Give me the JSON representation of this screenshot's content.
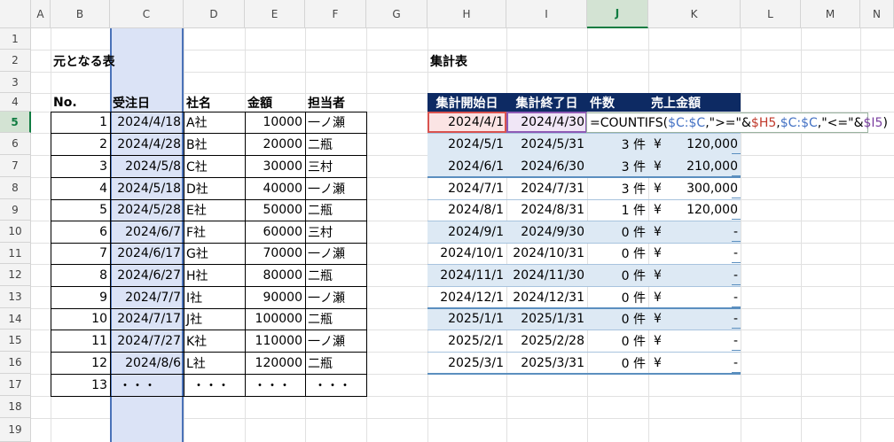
{
  "columns": [
    "A",
    "B",
    "C",
    "D",
    "E",
    "F",
    "G",
    "H",
    "I",
    "J",
    "K",
    "L",
    "M",
    "N"
  ],
  "rows": [
    "1",
    "2",
    "3",
    "4",
    "5",
    "6",
    "7",
    "8",
    "9",
    "10",
    "11",
    "12",
    "13",
    "14",
    "15",
    "16",
    "17",
    "18",
    "19"
  ],
  "active_row": "5",
  "active_column": "J",
  "left_title": "元となる表",
  "right_title": "集計表",
  "left_headers": [
    "No.",
    "受注日",
    "社名",
    "金額",
    "担当者"
  ],
  "left_rows": [
    [
      "1",
      "2024/4/18",
      "A社",
      "10000",
      "一ノ瀬"
    ],
    [
      "2",
      "2024/4/28",
      "B社",
      "20000",
      "二瓶"
    ],
    [
      "3",
      "2024/5/8",
      "C社",
      "30000",
      "三村"
    ],
    [
      "4",
      "2024/5/18",
      "D社",
      "40000",
      "一ノ瀬"
    ],
    [
      "5",
      "2024/5/28",
      "E社",
      "50000",
      "二瓶"
    ],
    [
      "6",
      "2024/6/7",
      "F社",
      "60000",
      "三村"
    ],
    [
      "7",
      "2024/6/17",
      "G社",
      "70000",
      "一ノ瀬"
    ],
    [
      "8",
      "2024/6/27",
      "H社",
      "80000",
      "二瓶"
    ],
    [
      "9",
      "2024/7/7",
      "I社",
      "90000",
      "一ノ瀬"
    ],
    [
      "10",
      "2024/7/17",
      "J社",
      "100000",
      "二瓶"
    ],
    [
      "11",
      "2024/7/27",
      "K社",
      "110000",
      "一ノ瀬"
    ],
    [
      "12",
      "2024/8/6",
      "L社",
      "120000",
      "二瓶"
    ],
    [
      "13",
      "・・・",
      "・・・",
      "・・・",
      "・・・"
    ]
  ],
  "right_headers": [
    "集計開始日",
    "集計終了日",
    "件数",
    "売上金額"
  ],
  "right_rows": [
    [
      "2024/4/1",
      "2024/4/30",
      "",
      ""
    ],
    [
      "2024/5/1",
      "2024/5/31",
      "3 件",
      "¥",
      "120,000"
    ],
    [
      "2024/6/1",
      "2024/6/30",
      "3 件",
      "¥",
      "210,000"
    ],
    [
      "2024/7/1",
      "2024/7/31",
      "3 件",
      "¥",
      "300,000"
    ],
    [
      "2024/8/1",
      "2024/8/31",
      "1 件",
      "¥",
      "120,000"
    ],
    [
      "2024/9/1",
      "2024/9/30",
      "0 件",
      "¥",
      "-"
    ],
    [
      "2024/10/1",
      "2024/10/31",
      "0 件",
      "¥",
      "-"
    ],
    [
      "2024/11/1",
      "2024/11/30",
      "0 件",
      "¥",
      "-"
    ],
    [
      "2024/12/1",
      "2024/12/31",
      "0 件",
      "¥",
      "-"
    ],
    [
      "2025/1/1",
      "2025/1/31",
      "0 件",
      "¥",
      "-"
    ],
    [
      "2025/2/1",
      "2025/2/28",
      "0 件",
      "¥",
      "-"
    ],
    [
      "2025/3/1",
      "2025/3/31",
      "0 件",
      "¥",
      "-"
    ]
  ],
  "formula": {
    "parts": [
      {
        "text": "=COUNTIFS(",
        "color": "#000000"
      },
      {
        "text": "$C:$C",
        "color": "#4472c4"
      },
      {
        "text": ",\">=\"&",
        "color": "#000000"
      },
      {
        "text": "$H5",
        "color": "#c0392b"
      },
      {
        "text": ",",
        "color": "#000000"
      },
      {
        "text": "$C:$C",
        "color": "#4472c4"
      },
      {
        "text": ",\"<=\"&",
        "color": "#000000"
      },
      {
        "text": "$I5",
        "color": "#7b3fa0"
      },
      {
        "text": ")",
        "color": "#000000"
      }
    ]
  },
  "colors": {
    "header_navy": "#0d2a63",
    "band_blue": "#dde9f4",
    "column_c_highlight": "#dbe3f6",
    "column_c_border": "#4a72b8",
    "ref_h5_fill": "#fbe4e4",
    "ref_h5_border": "#d9534f",
    "ref_i5_fill": "#f0e6f6",
    "ref_i5_border": "#8e5bb5",
    "excel_green": "#107c41"
  }
}
